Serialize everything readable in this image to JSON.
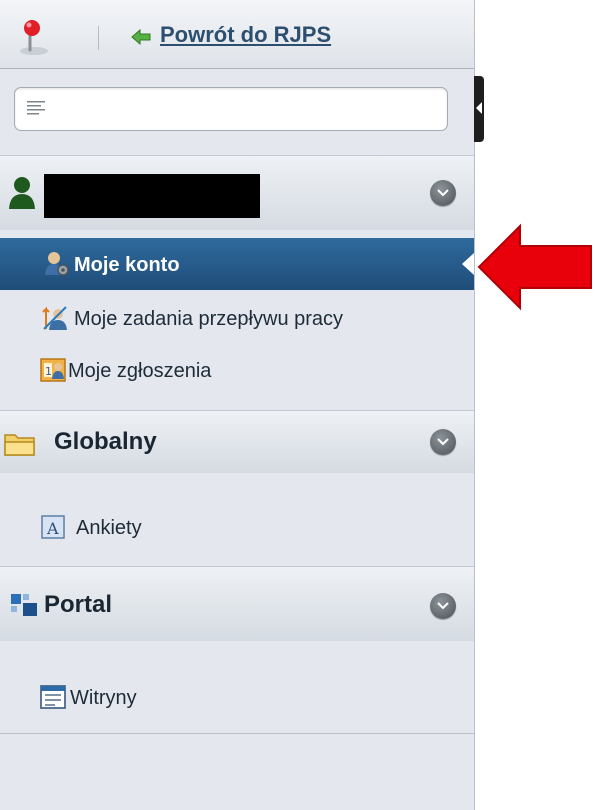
{
  "topbar": {
    "back_link": "Powrót do RJPS"
  },
  "search": {
    "value": "",
    "placeholder": ""
  },
  "sections": [
    {
      "title": "",
      "redacted": true,
      "items": [
        {
          "label": "Moje konto",
          "active": true,
          "icon": "user-settings-icon"
        },
        {
          "label": "Moje zadania przepływu pracy",
          "active": false,
          "icon": "workflow-tasks-icon"
        },
        {
          "label": "Moje zgłoszenia",
          "active": false,
          "icon": "requests-icon"
        }
      ]
    },
    {
      "title": "Globalny",
      "icon": "folder-icon",
      "items": [
        {
          "label": "Ankiety",
          "icon": "surveys-icon"
        }
      ]
    },
    {
      "title": "Portal",
      "icon": "portal-icon",
      "items": [
        {
          "label": "Witryny",
          "icon": "sites-icon"
        }
      ]
    }
  ],
  "colors": {
    "active_item": "#2a5e8e",
    "panel_bg": "#e4e8ee",
    "link": "#2d4f6f",
    "red_arrow": "#e8000b"
  }
}
